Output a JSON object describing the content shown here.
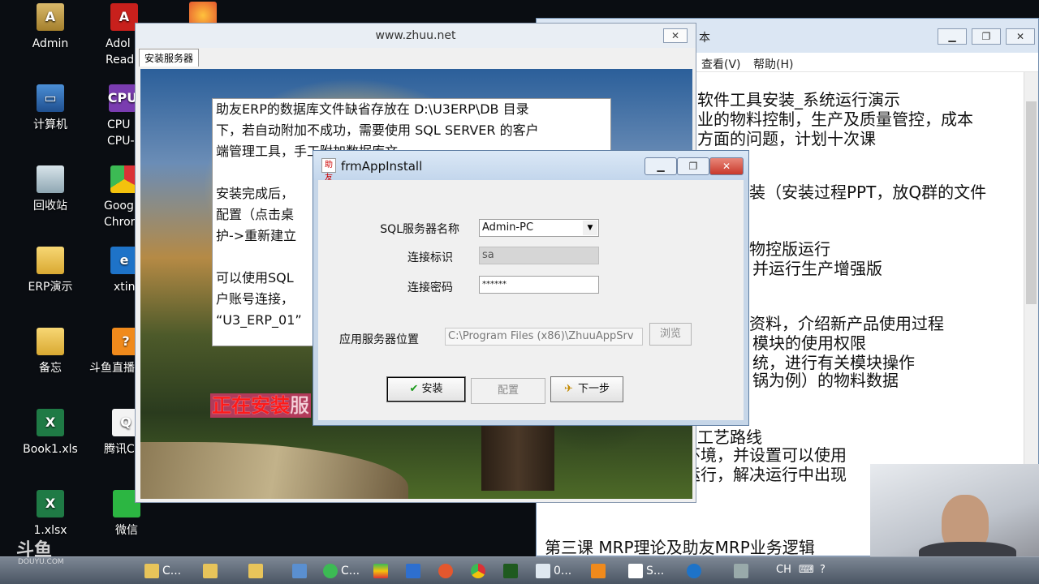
{
  "desktop": {
    "icons": [
      {
        "label": "Admin",
        "icon": "user-folder-icon"
      },
      {
        "label": "Adol Reade",
        "icon": "pdf-reader-icon"
      },
      {
        "label": "",
        "icon": "firefox-icon"
      },
      {
        "label": "计算机",
        "icon": "computer-icon"
      },
      {
        "label": "CPU CPU-",
        "icon": "cpu-z-icon"
      },
      {
        "label": "回收站",
        "icon": "recycle-bin-icon"
      },
      {
        "label": "Goog Chror",
        "icon": "chrome-icon"
      },
      {
        "label": "ERP演示",
        "icon": "folder-icon"
      },
      {
        "label": "xtin",
        "icon": "ie-icon"
      },
      {
        "label": "备忘",
        "icon": "folder-icon"
      },
      {
        "label": "斗鱼直播",
        "icon": "douyu-icon"
      },
      {
        "label": "Book1.xls",
        "icon": "excel-icon"
      },
      {
        "label": "腾讯C",
        "icon": "qq-icon"
      },
      {
        "label": "1.xlsx",
        "icon": "excel-icon"
      },
      {
        "label": "微信",
        "icon": "wechat-icon"
      }
    ]
  },
  "notepad": {
    "title": "本",
    "menu": [
      "查看(V)",
      "帮助(H)"
    ],
    "lines": [
      "软件工具安装_系统运行演示",
      "业的物料控制，生产及质量管控，成本",
      "方面的问题，计划十次课",
      "装（安装过程PPT，放Q群的文件",
      "物控版运行",
      "并运行生产增强版",
      "资料，介绍新产品使用过程",
      "模块的使用权限",
      "统，进行有关模块操作",
      "锅为例）的物料数据",
      "支工艺路线",
      "环境，并设置可以使用",
      "运行，解决运行中出现",
      "第三课 MRP理论及助友MRP业务逻辑"
    ]
  },
  "installer": {
    "title": "www.zhuu.net",
    "close": "✕",
    "tab": "安装服务器",
    "info_lines": [
      "助友ERP的数据库文件缺省存放在 D:\\U3ERP\\DB 目录",
      "下，若自动附加不成功，需要使用 SQL SERVER 的客户",
      "端管理工具，手工附加数据库文",
      "",
      "安装完成后，",
      "配置（点击桌",
      "护->重新建立",
      "",
      "可以使用SQL",
      "户账号连接，",
      "“U3_ERP_01”"
    ],
    "progress": "正在安装",
    "progress_tail": "服"
  },
  "dialog": {
    "title": "frmAppInstall",
    "app_icon": "助友",
    "min": "▁",
    "max": "❐",
    "close": "✕",
    "sql_server_label": "SQL服务器名称",
    "sql_server_value": "Admin-PC",
    "conn_id_label": "连接标识",
    "conn_id_value": "sa",
    "conn_pwd_label": "连接密码",
    "conn_pwd_value": "******",
    "app_server_label": "应用服务器位置",
    "app_server_value": "C:\\Program Files (x86)\\ZhuuAppSrv",
    "browse": "浏览",
    "install": "安装",
    "configure": "配置",
    "next": "下一步"
  },
  "taskbar": {
    "items": [
      "C...",
      "",
      "",
      "",
      "C...",
      "",
      "",
      "",
      "",
      "",
      "0...",
      "",
      "S...",
      "",
      ""
    ],
    "tray_lang": "CH",
    "watermark": "斗鱼",
    "watermark_sub": "DOUYU.COM"
  },
  "colors": {
    "progress_text": "#ff1a1a",
    "close_button": "#c8392b",
    "taskbar": "#4a5563"
  }
}
